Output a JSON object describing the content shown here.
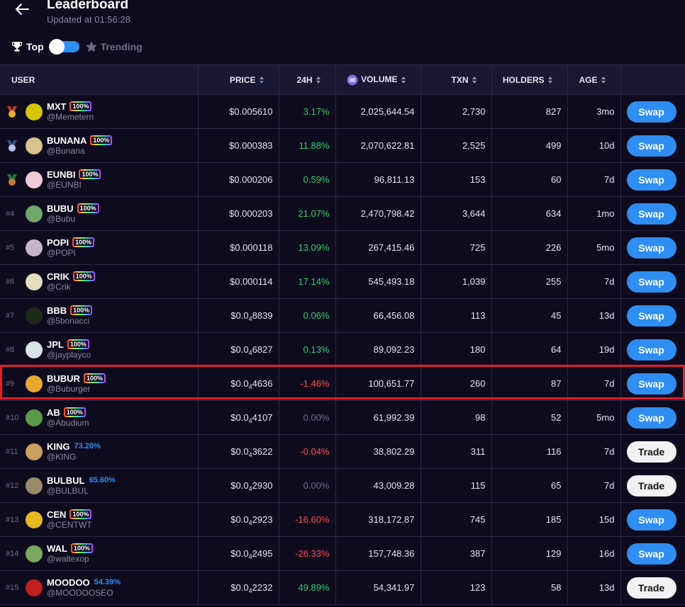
{
  "header": {
    "title": "Leaderboard",
    "updated_prefix": "Updated at ",
    "updated_time": "01:56:28"
  },
  "tabs": {
    "top_label": "Top",
    "trending_label": "Trending",
    "toggle_on": true
  },
  "columns": {
    "user": "USER",
    "price": "PRICE",
    "h24": "24H",
    "volume": "VOLUME",
    "txn": "TXN",
    "holders": "HOLDERS",
    "age": "AGE"
  },
  "colors": {
    "accent": "#2f8ef2",
    "positive": "#2fd06d",
    "negative": "#ff4d4d",
    "highlight": "#e0202a"
  },
  "rows": [
    {
      "rank": "1",
      "medal": "gold",
      "avatar": "#d6c400",
      "name": "MXT",
      "badge": "100%",
      "handle": "@Memetern",
      "price_a": "$0.005610",
      "price_sub": "",
      "price_b": "",
      "change": "3.17%",
      "dir": "pos",
      "volume": "2,025,644.54",
      "txn": "2,730",
      "holders": "827",
      "age": "3mo",
      "action": "Swap"
    },
    {
      "rank": "2",
      "medal": "silver",
      "avatar": "#d8c38a",
      "name": "BUNANA",
      "badge": "100%",
      "handle": "@Bunana",
      "price_a": "$0.000383",
      "price_sub": "",
      "price_b": "",
      "change": "11.88%",
      "dir": "pos",
      "volume": "2,070,622.81",
      "txn": "2,525",
      "holders": "499",
      "age": "10d",
      "action": "Swap"
    },
    {
      "rank": "3",
      "medal": "bronze",
      "avatar": "#f2c9d8",
      "name": "EUNBI",
      "badge": "100%",
      "handle": "@EUNBI",
      "price_a": "$0.000206",
      "price_sub": "",
      "price_b": "",
      "change": "0.59%",
      "dir": "pos",
      "volume": "96,811.13",
      "txn": "153",
      "holders": "60",
      "age": "7d",
      "action": "Swap"
    },
    {
      "rank": "#4",
      "medal": "",
      "avatar": "#6fa86a",
      "name": "BUBU",
      "badge": "100%",
      "handle": "@Bubu",
      "price_a": "$0.000203",
      "price_sub": "",
      "price_b": "",
      "change": "21.07%",
      "dir": "pos",
      "volume": "2,470,798.42",
      "txn": "3,644",
      "holders": "634",
      "age": "1mo",
      "action": "Swap"
    },
    {
      "rank": "#5",
      "medal": "",
      "avatar": "#c9b3c8",
      "name": "POPI",
      "badge": "100%",
      "handle": "@POPI",
      "price_a": "$0.000118",
      "price_sub": "",
      "price_b": "",
      "change": "13.09%",
      "dir": "pos",
      "volume": "267,415.46",
      "txn": "725",
      "holders": "226",
      "age": "5mo",
      "action": "Swap"
    },
    {
      "rank": "#6",
      "medal": "",
      "avatar": "#e8dcc0",
      "name": "CRIK",
      "badge": "100%",
      "handle": "@Crik",
      "price_a": "$0.000114",
      "price_sub": "",
      "price_b": "",
      "change": "17.14%",
      "dir": "pos",
      "volume": "545,493.18",
      "txn": "1,039",
      "holders": "255",
      "age": "7d",
      "action": "Swap"
    },
    {
      "rank": "#7",
      "medal": "",
      "avatar": "#1c2a1a",
      "name": "BBB",
      "badge": "100%",
      "handle": "@5bonacci",
      "price_a": "$0.0",
      "price_sub": "4",
      "price_b": "8839",
      "change": "0.06%",
      "dir": "pos",
      "volume": "66,456.08",
      "txn": "113",
      "holders": "45",
      "age": "13d",
      "action": "Swap"
    },
    {
      "rank": "#8",
      "medal": "",
      "avatar": "#d8e4ea",
      "name": "JPL",
      "badge": "100%",
      "handle": "@jayplayco",
      "price_a": "$0.0",
      "price_sub": "4",
      "price_b": "6827",
      "change": "0.13%",
      "dir": "pos",
      "volume": "89,092.23",
      "txn": "180",
      "holders": "64",
      "age": "19d",
      "action": "Swap"
    },
    {
      "rank": "#9",
      "medal": "",
      "avatar": "#e8a830",
      "name": "BUBUR",
      "badge": "100%",
      "handle": "@Buburger",
      "price_a": "$0.0",
      "price_sub": "4",
      "price_b": "4636",
      "change": "-1.46%",
      "dir": "neg",
      "volume": "100,651.77",
      "txn": "260",
      "holders": "87",
      "age": "7d",
      "action": "Swap"
    },
    {
      "rank": "#10",
      "medal": "",
      "avatar": "#5a9a4a",
      "name": "AB",
      "badge": "100%",
      "handle": "@Abudium",
      "price_a": "$0.0",
      "price_sub": "4",
      "price_b": "4107",
      "change": "0.00%",
      "dir": "zero",
      "volume": "61,992.39",
      "txn": "98",
      "holders": "52",
      "age": "5mo",
      "action": "Swap"
    },
    {
      "rank": "#11",
      "medal": "",
      "avatar": "#c9a060",
      "name": "KING",
      "badge": "",
      "pct": "73.20%",
      "handle": "@KING",
      "price_a": "$0.0",
      "price_sub": "4",
      "price_b": "3622",
      "change": "-0.04%",
      "dir": "neg",
      "volume": "38,802.29",
      "txn": "311",
      "holders": "116",
      "age": "7d",
      "action": "Trade"
    },
    {
      "rank": "#12",
      "medal": "",
      "avatar": "#9a8a6a",
      "name": "BULBUL",
      "badge": "",
      "pct": "65.60%",
      "handle": "@BULBUL",
      "price_a": "$0.0",
      "price_sub": "4",
      "price_b": "2930",
      "change": "0.00%",
      "dir": "zero",
      "volume": "43,009.28",
      "txn": "115",
      "holders": "65",
      "age": "7d",
      "action": "Trade"
    },
    {
      "rank": "#13",
      "medal": "",
      "avatar": "#e8b820",
      "name": "CEN",
      "badge": "100%",
      "handle": "@CENTWT",
      "price_a": "$0.0",
      "price_sub": "4",
      "price_b": "2923",
      "change": "-16.60%",
      "dir": "neg",
      "volume": "318,172.87",
      "txn": "745",
      "holders": "185",
      "age": "15d",
      "action": "Swap"
    },
    {
      "rank": "#14",
      "medal": "",
      "avatar": "#7aa860",
      "name": "WAL",
      "badge": "100%",
      "handle": "@waltexop",
      "price_a": "$0.0",
      "price_sub": "4",
      "price_b": "2495",
      "change": "-26.33%",
      "dir": "neg",
      "volume": "157,748.36",
      "txn": "387",
      "holders": "129",
      "age": "16d",
      "action": "Swap"
    },
    {
      "rank": "#15",
      "medal": "",
      "avatar": "#c02020",
      "name": "MOODOO",
      "badge": "",
      "pct": "54.39%",
      "handle": "@MOODOOSEO",
      "price_a": "$0.0",
      "price_sub": "4",
      "price_b": "2232",
      "change": "49.89%",
      "dir": "pos",
      "volume": "54,341.97",
      "txn": "123",
      "holders": "58",
      "age": "13d",
      "action": "Trade"
    }
  ]
}
